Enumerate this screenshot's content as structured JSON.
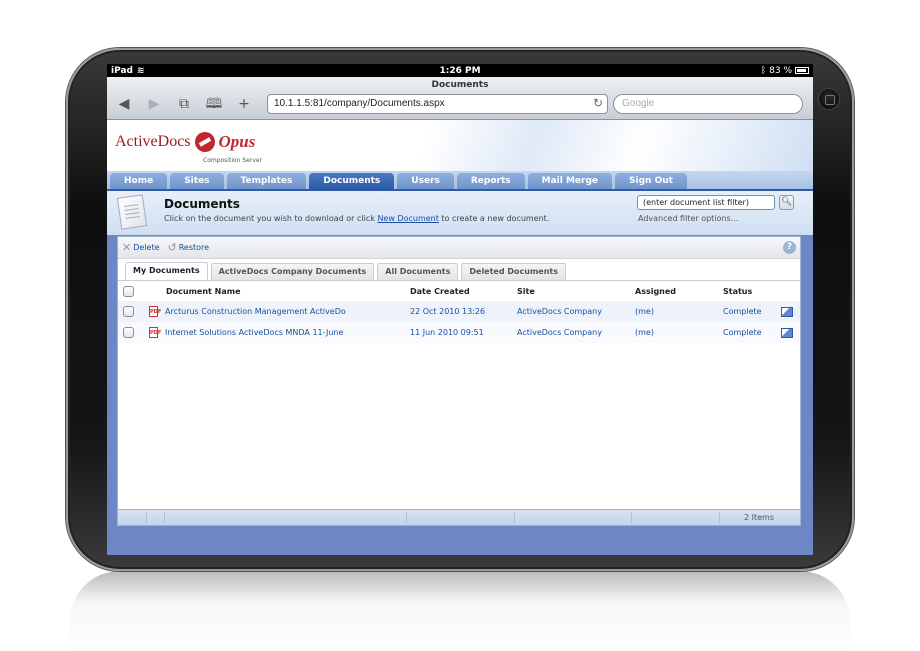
{
  "statusbar": {
    "device": "iPad",
    "time": "1:26 PM",
    "battery": "83 %"
  },
  "browser": {
    "title": "Documents",
    "url": "10.1.1.5:81/company/Documents.aspx",
    "search_placeholder": "Google"
  },
  "brand": {
    "name": "ActiveDocs",
    "product": "Opus",
    "subtitle": "Composition Server"
  },
  "tabs": [
    "Home",
    "Sites",
    "Templates",
    "Documents",
    "Users",
    "Reports",
    "Mail Merge",
    "Sign Out"
  ],
  "page": {
    "title": "Documents",
    "desc_before": "Click on the document you wish to download or click ",
    "desc_link": "New Document",
    "desc_after": " to create a new document.",
    "filter_value": "(enter document list filter)",
    "advanced_filter": "Advanced filter options..."
  },
  "toolbar": {
    "delete_label": "Delete",
    "restore_label": "Restore",
    "help": "?"
  },
  "subtabs": [
    "My Documents",
    "ActiveDocs Company Documents",
    "All Documents",
    "Deleted Documents"
  ],
  "columns": {
    "name": "Document Name",
    "date": "Date Created",
    "site": "Site",
    "assigned": "Assigned",
    "status": "Status"
  },
  "rows": [
    {
      "name": "Arcturus Construction Management ActiveDo",
      "date": "22 Oct 2010 13:26",
      "site": "ActiveDocs Company",
      "assigned": "(me)",
      "status": "Complete"
    },
    {
      "name": "Internet Solutions ActiveDocs MNDA 11-June",
      "date": "11 Jun 2010 09:51",
      "site": "ActiveDocs Company",
      "assigned": "(me)",
      "status": "Complete"
    }
  ],
  "footer": {
    "count": "2 Items"
  },
  "colors": {
    "active_tab": "#2d5aa5",
    "link": "#1a4fa0",
    "brand_red": "#c1272d"
  }
}
